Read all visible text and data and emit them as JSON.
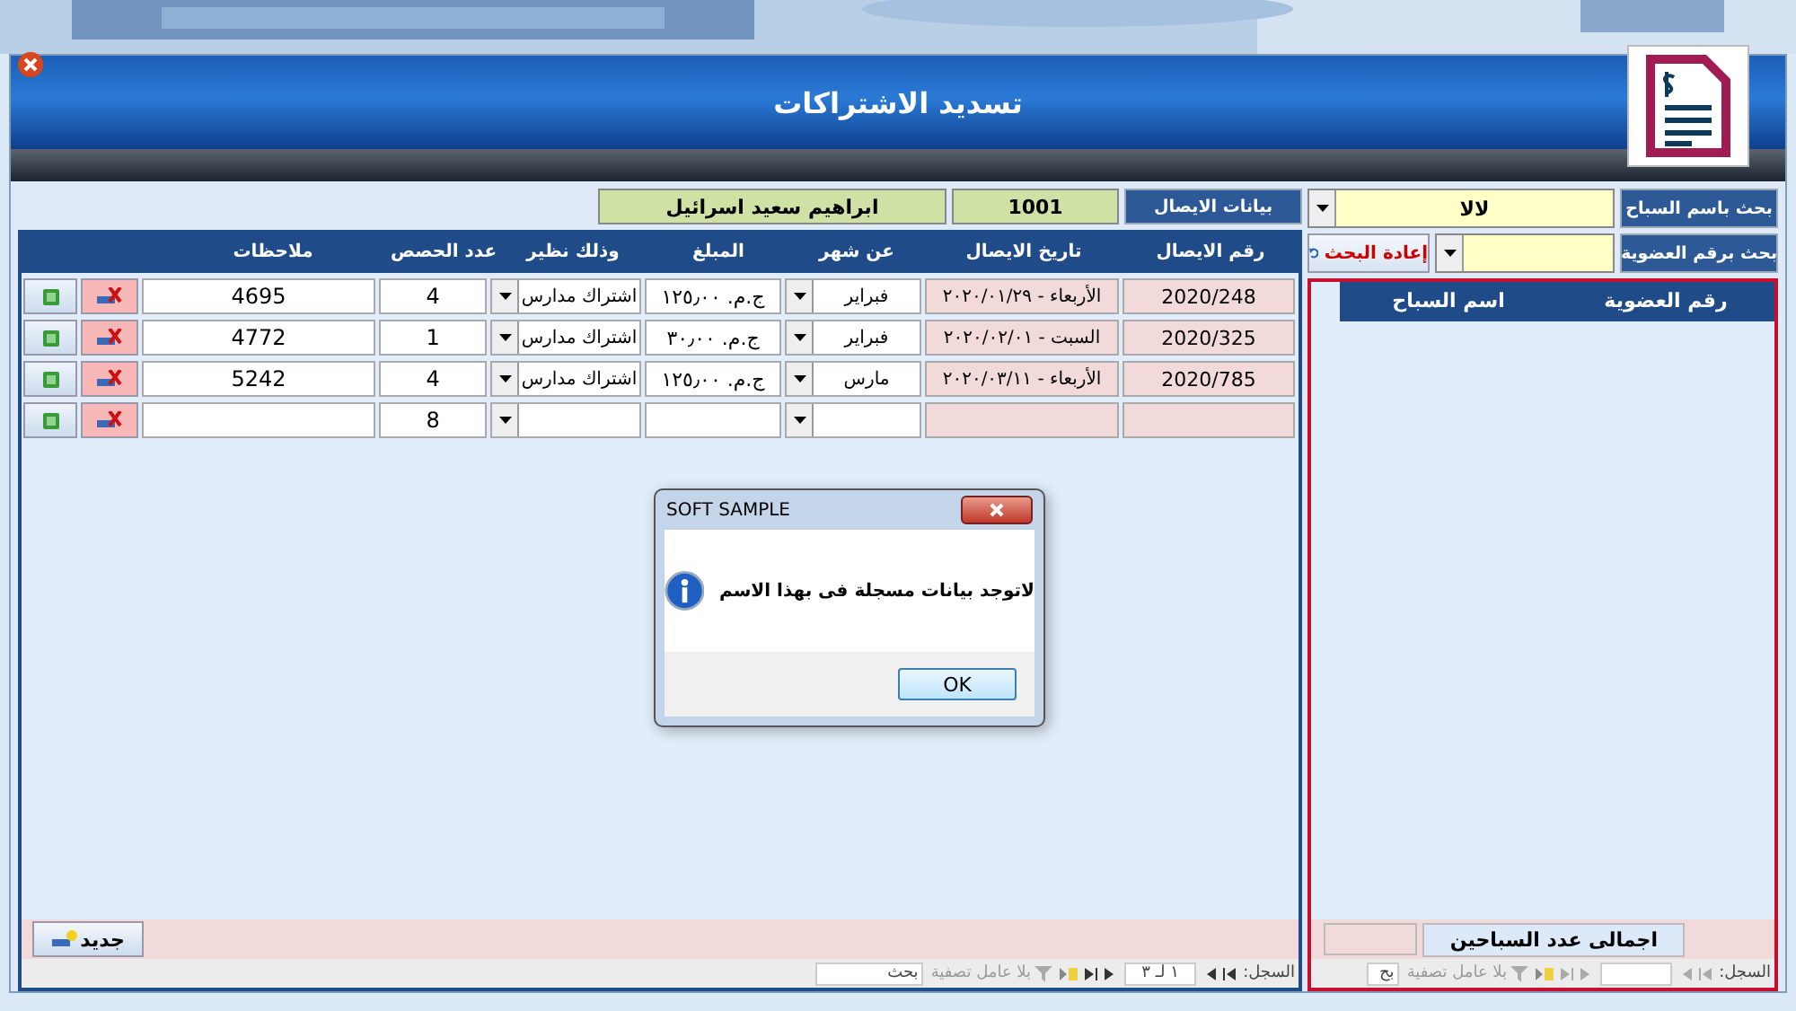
{
  "window": {
    "title": "تسديد الاشتراكات"
  },
  "search": {
    "by_name_label": "بحث باسم السباح",
    "by_name_value": "لالا",
    "by_member_label": "بحث برقم العضوية",
    "reset_button": "إعادة البحث"
  },
  "members_list": {
    "columns": [
      "رقم العضوية",
      "اسم السباح"
    ],
    "total_label": "اجمالى عدد السباحين",
    "nav": {
      "record_label": "السجل:",
      "filter": "بلا عامل تصفية",
      "search": "بح"
    }
  },
  "receipt": {
    "label": "بيانات الايصال",
    "number": "1001",
    "name": "ابراهيم سعيد اسرائيل"
  },
  "table": {
    "columns": [
      "رقم الايصال",
      "تاريخ الايصال",
      "عن شهر",
      "المبلغ",
      "وذلك نظير",
      "عدد الحصص",
      "ملاحظات"
    ],
    "rows": [
      {
        "receipt": "2020/248",
        "date": "الأربعاء - ٢٠٢٠/٠١/٢٩",
        "month": "فبراير",
        "amount": "ج.م. ١٢٥٫٠٠",
        "purpose": "اشتراك مدارس",
        "sessions": "4",
        "notes": "4695"
      },
      {
        "receipt": "2020/325",
        "date": "السبت - ٢٠٢٠/٠٢/٠١",
        "month": "فبراير",
        "amount": "ج.م. ٣٠٫٠٠",
        "purpose": "اشتراك مدارس",
        "sessions": "1",
        "notes": "4772"
      },
      {
        "receipt": "2020/785",
        "date": "الأربعاء - ٢٠٢٠/٠٣/١١",
        "month": "مارس",
        "amount": "ج.م. ١٢٥٫٠٠",
        "purpose": "اشتراك مدارس",
        "sessions": "4",
        "notes": "5242"
      },
      {
        "sessions": "8"
      }
    ]
  },
  "new_button": "جديد",
  "nav": {
    "record_label": "السجل:",
    "position": "١ لـ ٣",
    "filter": "بلا عامل تصفية",
    "search": "بحث"
  },
  "dialog": {
    "title": "SOFT SAMPLE",
    "message": "لاتوجد بيانات مسجلة فى بهذا الاسم",
    "ok": "OK"
  }
}
